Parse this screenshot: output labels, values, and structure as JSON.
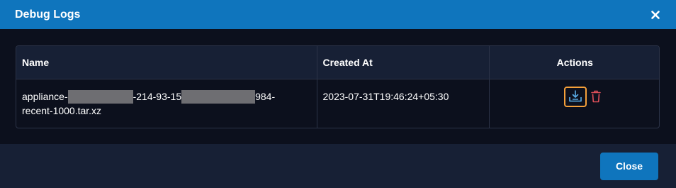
{
  "dialog": {
    "title": "Debug Logs"
  },
  "table": {
    "headers": {
      "name": "Name",
      "created_at": "Created At",
      "actions": "Actions"
    },
    "rows": [
      {
        "name_part1": "appliance-",
        "name_part2": "-214-93-15",
        "name_part3": "984-",
        "name_part4": "recent-1000.tar.xz",
        "created_at": "2023-07-31T19:46:24+05:30"
      }
    ]
  },
  "footer": {
    "close_label": "Close"
  },
  "colors": {
    "header_bg": "#0f75bd",
    "highlight": "#f5a03a",
    "delete": "#e0505a",
    "download": "#5aaee8"
  }
}
